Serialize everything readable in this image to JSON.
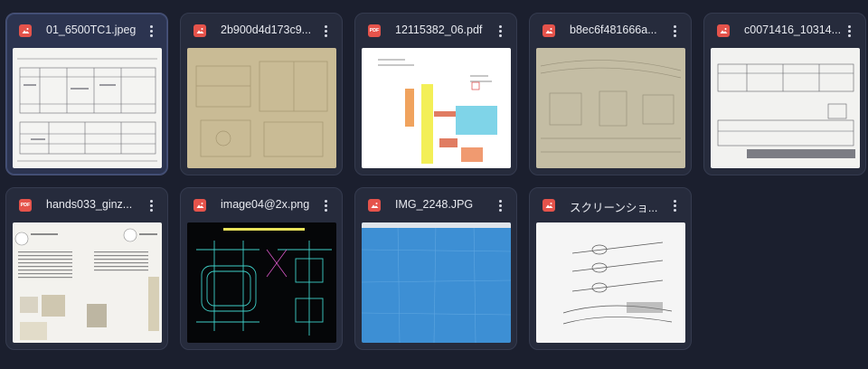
{
  "files": [
    {
      "name": "01_6500TC1.jpeg",
      "type": "image",
      "selected": true
    },
    {
      "name": "2b900d4d173c9...",
      "type": "image",
      "selected": false
    },
    {
      "name": "12115382_06.pdf",
      "type": "pdf",
      "selected": false
    },
    {
      "name": "b8ec6f481666a...",
      "type": "image",
      "selected": false
    },
    {
      "name": "c0071416_10314...",
      "type": "image",
      "selected": false
    },
    {
      "name": "hands033_ginz...",
      "type": "pdf",
      "selected": false
    },
    {
      "name": "image04@2x.png",
      "type": "image",
      "selected": false
    },
    {
      "name": "IMG_2248.JPG",
      "type": "image",
      "selected": false
    },
    {
      "name": "スクリーンショ...",
      "type": "image",
      "selected": false
    }
  ],
  "pdf_badge": "PDF",
  "colors": {
    "background": "#1b1f2e",
    "card": "#262b3c",
    "card_selected": "#2c3450",
    "file_type_accent": "#e5534b",
    "text": "#e8eaf0"
  }
}
